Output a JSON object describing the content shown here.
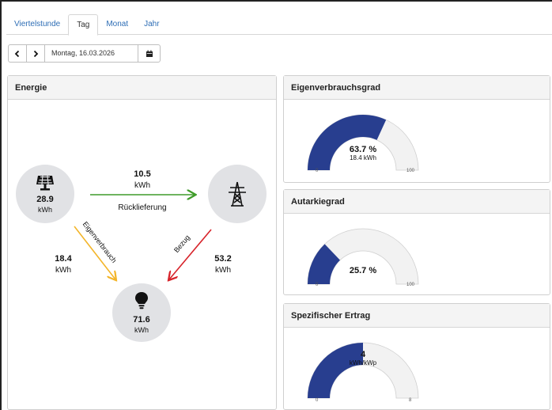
{
  "tabs": [
    "Viertelstunde",
    "Tag",
    "Monat",
    "Jahr"
  ],
  "active_tab": "Tag",
  "date": "Montag, 16.03.2026",
  "energy": {
    "title": "Energie",
    "pv": {
      "value": "28.9",
      "unit": "kWh"
    },
    "feed_in": {
      "value": "10.5",
      "unit": "kWh",
      "label": "Rücklieferung"
    },
    "self_consumption": {
      "value": "18.4",
      "unit": "kWh",
      "label": "Eigenverbrauch"
    },
    "purchase": {
      "value": "53.2",
      "unit": "kWh",
      "label": "Bezug"
    },
    "consumption": {
      "value": "71.6",
      "unit": "kWh"
    },
    "colors": {
      "feed_in": "#3f9c2a",
      "self_consumption": "#f3b52a",
      "purchase": "#d7232a",
      "node": "#e1e2e5"
    }
  },
  "gauges": [
    {
      "title": "Eigenverbrauchsgrad",
      "value": "63.7 %",
      "sub": "18.4 kWh",
      "fraction": 0.637,
      "min": "0",
      "max": "100"
    },
    {
      "title": "Autarkiegrad",
      "value": "25.7 %",
      "sub": "",
      "fraction": 0.257,
      "min": "0",
      "max": "100"
    },
    {
      "title": "Spezifischer Ertrag",
      "value": "4",
      "sub": "kWh/kWp",
      "fraction": 0.5,
      "min": "0",
      "max": "8"
    }
  ],
  "colors": {
    "gauge_fill": "#283e8f",
    "gauge_track": "#f2f2f2",
    "link": "#2d6db5"
  }
}
